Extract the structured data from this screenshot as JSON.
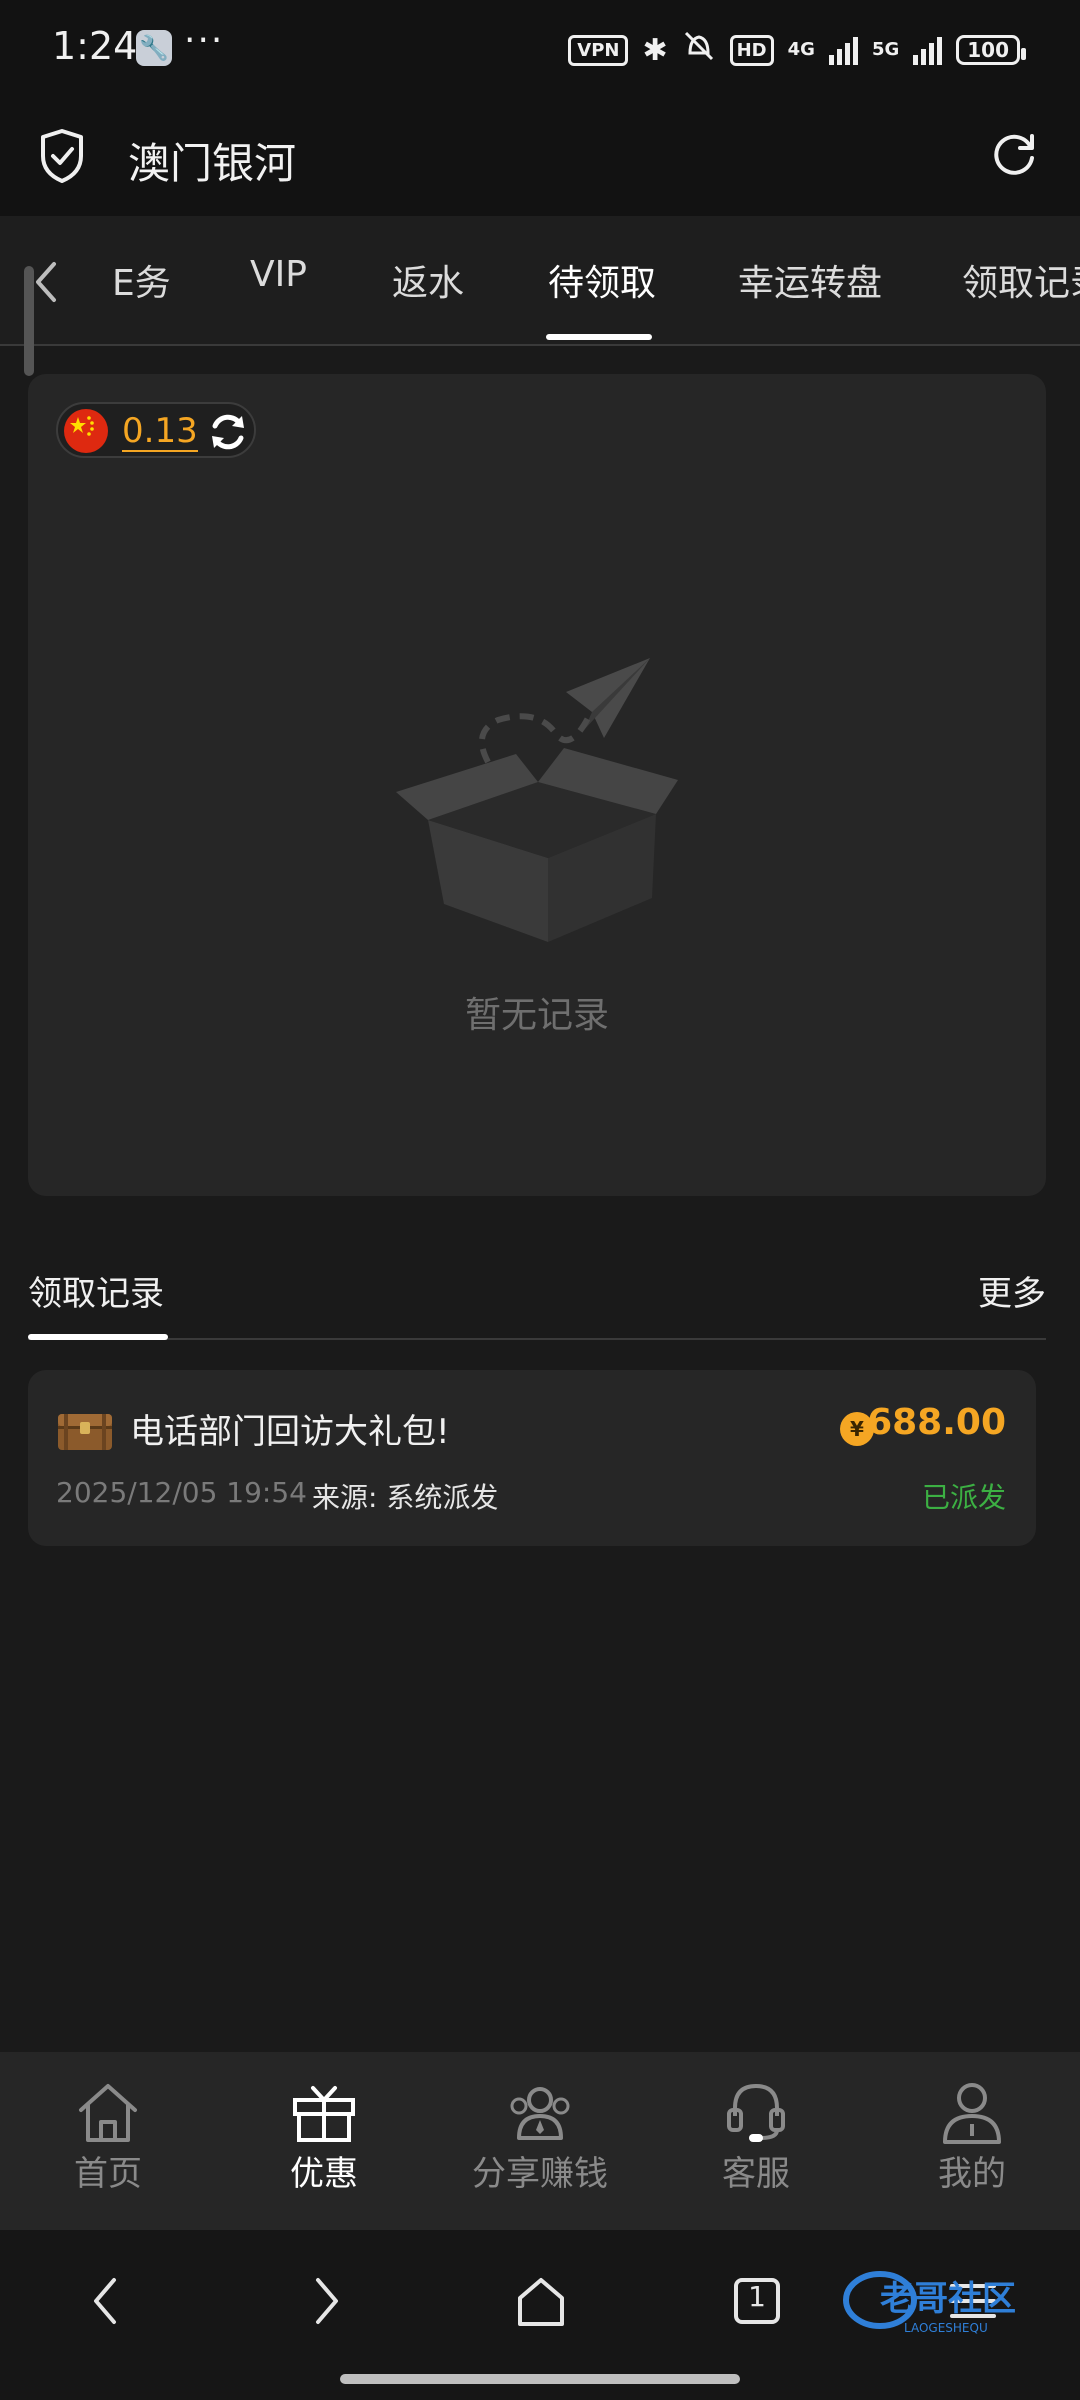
{
  "status_bar": {
    "time": "1:24",
    "dots": "···",
    "vpn": "VPN",
    "hd": "HD",
    "net1": "4G",
    "net2": "5G",
    "battery": "100"
  },
  "app": {
    "title": "澳门银河"
  },
  "tabs": {
    "items": [
      "E务",
      "VIP",
      "返水",
      "待领取",
      "幸运转盘",
      "领取记录"
    ],
    "active_index": 3
  },
  "balance": {
    "value": "0.13"
  },
  "empty_state": {
    "text": "暂无记录"
  },
  "records": {
    "title": "领取记录",
    "more": "更多",
    "items": [
      {
        "name": "电话部门回访大礼包!",
        "currency_symbol": "¥",
        "amount": "688.00",
        "date": "2025/12/05 19:54",
        "source": "来源: 系统派发",
        "status": "已派发"
      }
    ]
  },
  "bottom_nav": {
    "items": [
      "首页",
      "优惠",
      "分享赚钱",
      "客服",
      "我的"
    ],
    "active_index": 1
  },
  "system_nav": {
    "tab_count": "1"
  },
  "watermark": {
    "text": "老哥社区",
    "subtext": "LAOGESHEQU"
  },
  "colors": {
    "accent": "#f5a623",
    "success": "#3cb043",
    "background": "#1a1a1a",
    "card": "#262626"
  },
  "icons": [
    "shield-icon",
    "refresh-icon",
    "chevron-left-icon",
    "flag-icon",
    "sync-icon",
    "empty-box-icon",
    "chest-icon",
    "coin-icon",
    "home-icon",
    "gift-icon",
    "share-icon",
    "headset-icon",
    "user-icon"
  ]
}
